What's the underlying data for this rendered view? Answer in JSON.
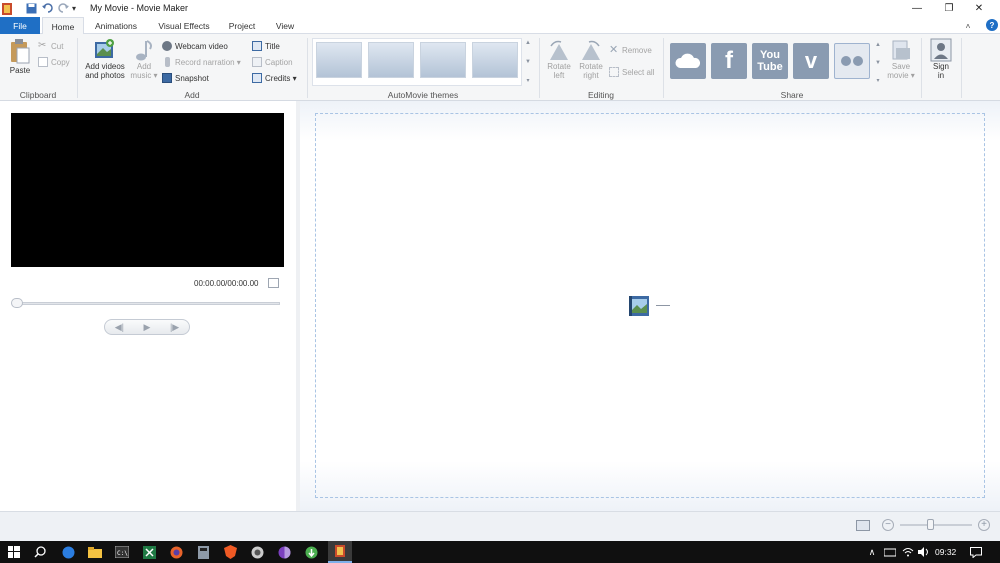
{
  "app": {
    "window_title": "My Movie - Movie Maker",
    "qa_more": "▾",
    "controls": {
      "minimize": "—",
      "maximize": "❐",
      "close": "✕"
    }
  },
  "tabs": [
    {
      "label": "File"
    },
    {
      "label": "Home"
    },
    {
      "label": "Animations"
    },
    {
      "label": "Visual Effects"
    },
    {
      "label": "Project"
    },
    {
      "label": "View"
    }
  ],
  "ribbon_aux": {
    "collapse": "˄",
    "help": "?"
  },
  "ribbon": {
    "clipboard": {
      "label": "Clipboard",
      "paste": "Paste",
      "cut": "Cut",
      "copy": "Copy"
    },
    "add": {
      "label": "Add",
      "add_videos_line1": "Add videos",
      "add_videos_line2": "and photos",
      "add_music_line1": "Add",
      "add_music_line2": "music ▾",
      "webcam": "Webcam video",
      "narration": "Record narration ▾",
      "snapshot": "Snapshot",
      "title": "Title",
      "caption": "Caption",
      "credits": "Credits ▾"
    },
    "themes": {
      "label": "AutoMovie themes",
      "count": 4
    },
    "editing": {
      "label": "Editing",
      "rotate_left_line1": "Rotate",
      "rotate_left_line2": "left",
      "rotate_right_line1": "Rotate",
      "rotate_right_line2": "right",
      "remove": "Remove",
      "select_all": "Select all"
    },
    "share": {
      "label": "Share",
      "youtube_line1": "You",
      "youtube_line2": "Tube",
      "vimeo": "v",
      "facebook": "f",
      "save_movie_line1": "Save",
      "save_movie_line2": "movie ▾"
    },
    "account": {
      "sign_in_line1": "Sign",
      "sign_in_line2": "in"
    }
  },
  "preview": {
    "time": "00:00.00/00:00.00",
    "seek_fraction": 0
  },
  "status": {
    "zoom_minus": "−",
    "zoom_plus": "+",
    "zoom_fraction": 0.42
  },
  "taskbar": {
    "clock": "09:32",
    "tray_up": "∧"
  },
  "colors": {
    "file_tab": "#1f6fc5",
    "ribbon_bg": "#f5f6f7",
    "storyboard_border": "#a9c4e4",
    "taskbar": "#101010"
  }
}
